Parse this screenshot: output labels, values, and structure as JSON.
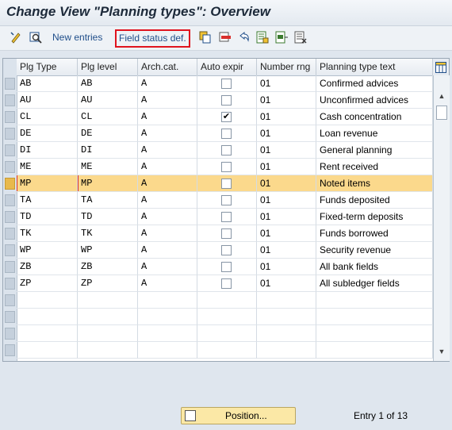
{
  "window": {
    "title": "Change View \"Planning types\": Overview"
  },
  "toolbar": {
    "new_entries": "New entries",
    "field_status_def": "Field status def.",
    "icons": [
      "edit-toggle-icon",
      "display-change-icon",
      "copy-icon",
      "delete-icon",
      "undo-icon",
      "select-all-icon",
      "select-block-icon",
      "deselect-all-icon"
    ]
  },
  "table": {
    "columns": [
      "Plg Type",
      "Plg level",
      "Arch.cat.",
      "Auto expir",
      "Number rng",
      "Planning type text"
    ],
    "rows": [
      {
        "type": "AB",
        "level": "AB",
        "arch": "A",
        "auto": false,
        "num": "01",
        "text": "Confirmed advices"
      },
      {
        "type": "AU",
        "level": "AU",
        "arch": "A",
        "auto": false,
        "num": "01",
        "text": "Unconfirmed advices"
      },
      {
        "type": "CL",
        "level": "CL",
        "arch": "A",
        "auto": true,
        "num": "01",
        "text": "Cash concentration"
      },
      {
        "type": "DE",
        "level": "DE",
        "arch": "A",
        "auto": false,
        "num": "01",
        "text": "Loan revenue"
      },
      {
        "type": "DI",
        "level": "DI",
        "arch": "A",
        "auto": false,
        "num": "01",
        "text": "General planning"
      },
      {
        "type": "ME",
        "level": "ME",
        "arch": "A",
        "auto": false,
        "num": "01",
        "text": "Rent received"
      },
      {
        "type": "MP",
        "level": "MP",
        "arch": "A",
        "auto": false,
        "num": "01",
        "text": "Noted items"
      },
      {
        "type": "TA",
        "level": "TA",
        "arch": "A",
        "auto": false,
        "num": "01",
        "text": "Funds deposited"
      },
      {
        "type": "TD",
        "level": "TD",
        "arch": "A",
        "auto": false,
        "num": "01",
        "text": "Fixed-term deposits"
      },
      {
        "type": "TK",
        "level": "TK",
        "arch": "A",
        "auto": false,
        "num": "01",
        "text": "Funds borrowed"
      },
      {
        "type": "WP",
        "level": "WP",
        "arch": "A",
        "auto": false,
        "num": "01",
        "text": "Security revenue"
      },
      {
        "type": "ZB",
        "level": "ZB",
        "arch": "A",
        "auto": false,
        "num": "01",
        "text": "All bank fields"
      },
      {
        "type": "ZP",
        "level": "ZP",
        "arch": "A",
        "auto": false,
        "num": "01",
        "text": "All subledger fields"
      }
    ],
    "highlighted_row": "MP",
    "empty_rows": 4
  },
  "footer": {
    "position_label": "Position...",
    "entry_text": "Entry 1 of 13"
  },
  "colors": {
    "highlight": "#fbd98c",
    "accent_border": "#e0141e",
    "link": "#1f4e8a"
  }
}
